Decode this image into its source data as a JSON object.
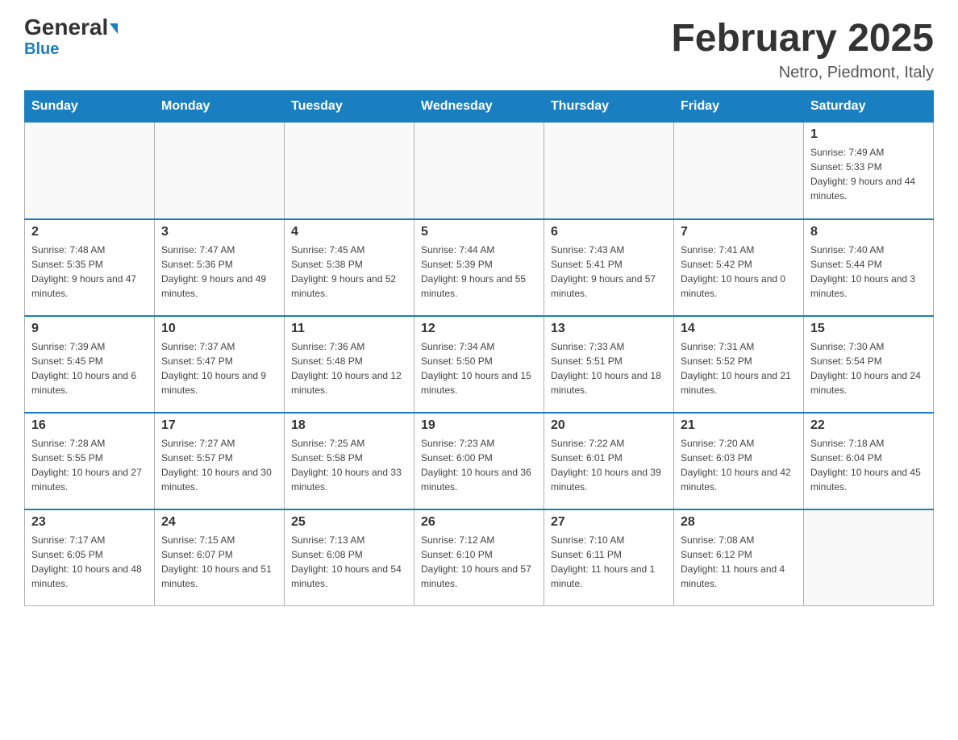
{
  "header": {
    "logo_main": "General",
    "logo_sub": "Blue",
    "month_title": "February 2025",
    "location": "Netro, Piedmont, Italy"
  },
  "weekdays": [
    "Sunday",
    "Monday",
    "Tuesday",
    "Wednesday",
    "Thursday",
    "Friday",
    "Saturday"
  ],
  "weeks": [
    [
      {
        "day": "",
        "info": ""
      },
      {
        "day": "",
        "info": ""
      },
      {
        "day": "",
        "info": ""
      },
      {
        "day": "",
        "info": ""
      },
      {
        "day": "",
        "info": ""
      },
      {
        "day": "",
        "info": ""
      },
      {
        "day": "1",
        "info": "Sunrise: 7:49 AM\nSunset: 5:33 PM\nDaylight: 9 hours and 44 minutes."
      }
    ],
    [
      {
        "day": "2",
        "info": "Sunrise: 7:48 AM\nSunset: 5:35 PM\nDaylight: 9 hours and 47 minutes."
      },
      {
        "day": "3",
        "info": "Sunrise: 7:47 AM\nSunset: 5:36 PM\nDaylight: 9 hours and 49 minutes."
      },
      {
        "day": "4",
        "info": "Sunrise: 7:45 AM\nSunset: 5:38 PM\nDaylight: 9 hours and 52 minutes."
      },
      {
        "day": "5",
        "info": "Sunrise: 7:44 AM\nSunset: 5:39 PM\nDaylight: 9 hours and 55 minutes."
      },
      {
        "day": "6",
        "info": "Sunrise: 7:43 AM\nSunset: 5:41 PM\nDaylight: 9 hours and 57 minutes."
      },
      {
        "day": "7",
        "info": "Sunrise: 7:41 AM\nSunset: 5:42 PM\nDaylight: 10 hours and 0 minutes."
      },
      {
        "day": "8",
        "info": "Sunrise: 7:40 AM\nSunset: 5:44 PM\nDaylight: 10 hours and 3 minutes."
      }
    ],
    [
      {
        "day": "9",
        "info": "Sunrise: 7:39 AM\nSunset: 5:45 PM\nDaylight: 10 hours and 6 minutes."
      },
      {
        "day": "10",
        "info": "Sunrise: 7:37 AM\nSunset: 5:47 PM\nDaylight: 10 hours and 9 minutes."
      },
      {
        "day": "11",
        "info": "Sunrise: 7:36 AM\nSunset: 5:48 PM\nDaylight: 10 hours and 12 minutes."
      },
      {
        "day": "12",
        "info": "Sunrise: 7:34 AM\nSunset: 5:50 PM\nDaylight: 10 hours and 15 minutes."
      },
      {
        "day": "13",
        "info": "Sunrise: 7:33 AM\nSunset: 5:51 PM\nDaylight: 10 hours and 18 minutes."
      },
      {
        "day": "14",
        "info": "Sunrise: 7:31 AM\nSunset: 5:52 PM\nDaylight: 10 hours and 21 minutes."
      },
      {
        "day": "15",
        "info": "Sunrise: 7:30 AM\nSunset: 5:54 PM\nDaylight: 10 hours and 24 minutes."
      }
    ],
    [
      {
        "day": "16",
        "info": "Sunrise: 7:28 AM\nSunset: 5:55 PM\nDaylight: 10 hours and 27 minutes."
      },
      {
        "day": "17",
        "info": "Sunrise: 7:27 AM\nSunset: 5:57 PM\nDaylight: 10 hours and 30 minutes."
      },
      {
        "day": "18",
        "info": "Sunrise: 7:25 AM\nSunset: 5:58 PM\nDaylight: 10 hours and 33 minutes."
      },
      {
        "day": "19",
        "info": "Sunrise: 7:23 AM\nSunset: 6:00 PM\nDaylight: 10 hours and 36 minutes."
      },
      {
        "day": "20",
        "info": "Sunrise: 7:22 AM\nSunset: 6:01 PM\nDaylight: 10 hours and 39 minutes."
      },
      {
        "day": "21",
        "info": "Sunrise: 7:20 AM\nSunset: 6:03 PM\nDaylight: 10 hours and 42 minutes."
      },
      {
        "day": "22",
        "info": "Sunrise: 7:18 AM\nSunset: 6:04 PM\nDaylight: 10 hours and 45 minutes."
      }
    ],
    [
      {
        "day": "23",
        "info": "Sunrise: 7:17 AM\nSunset: 6:05 PM\nDaylight: 10 hours and 48 minutes."
      },
      {
        "day": "24",
        "info": "Sunrise: 7:15 AM\nSunset: 6:07 PM\nDaylight: 10 hours and 51 minutes."
      },
      {
        "day": "25",
        "info": "Sunrise: 7:13 AM\nSunset: 6:08 PM\nDaylight: 10 hours and 54 minutes."
      },
      {
        "day": "26",
        "info": "Sunrise: 7:12 AM\nSunset: 6:10 PM\nDaylight: 10 hours and 57 minutes."
      },
      {
        "day": "27",
        "info": "Sunrise: 7:10 AM\nSunset: 6:11 PM\nDaylight: 11 hours and 1 minute."
      },
      {
        "day": "28",
        "info": "Sunrise: 7:08 AM\nSunset: 6:12 PM\nDaylight: 11 hours and 4 minutes."
      },
      {
        "day": "",
        "info": ""
      }
    ]
  ]
}
